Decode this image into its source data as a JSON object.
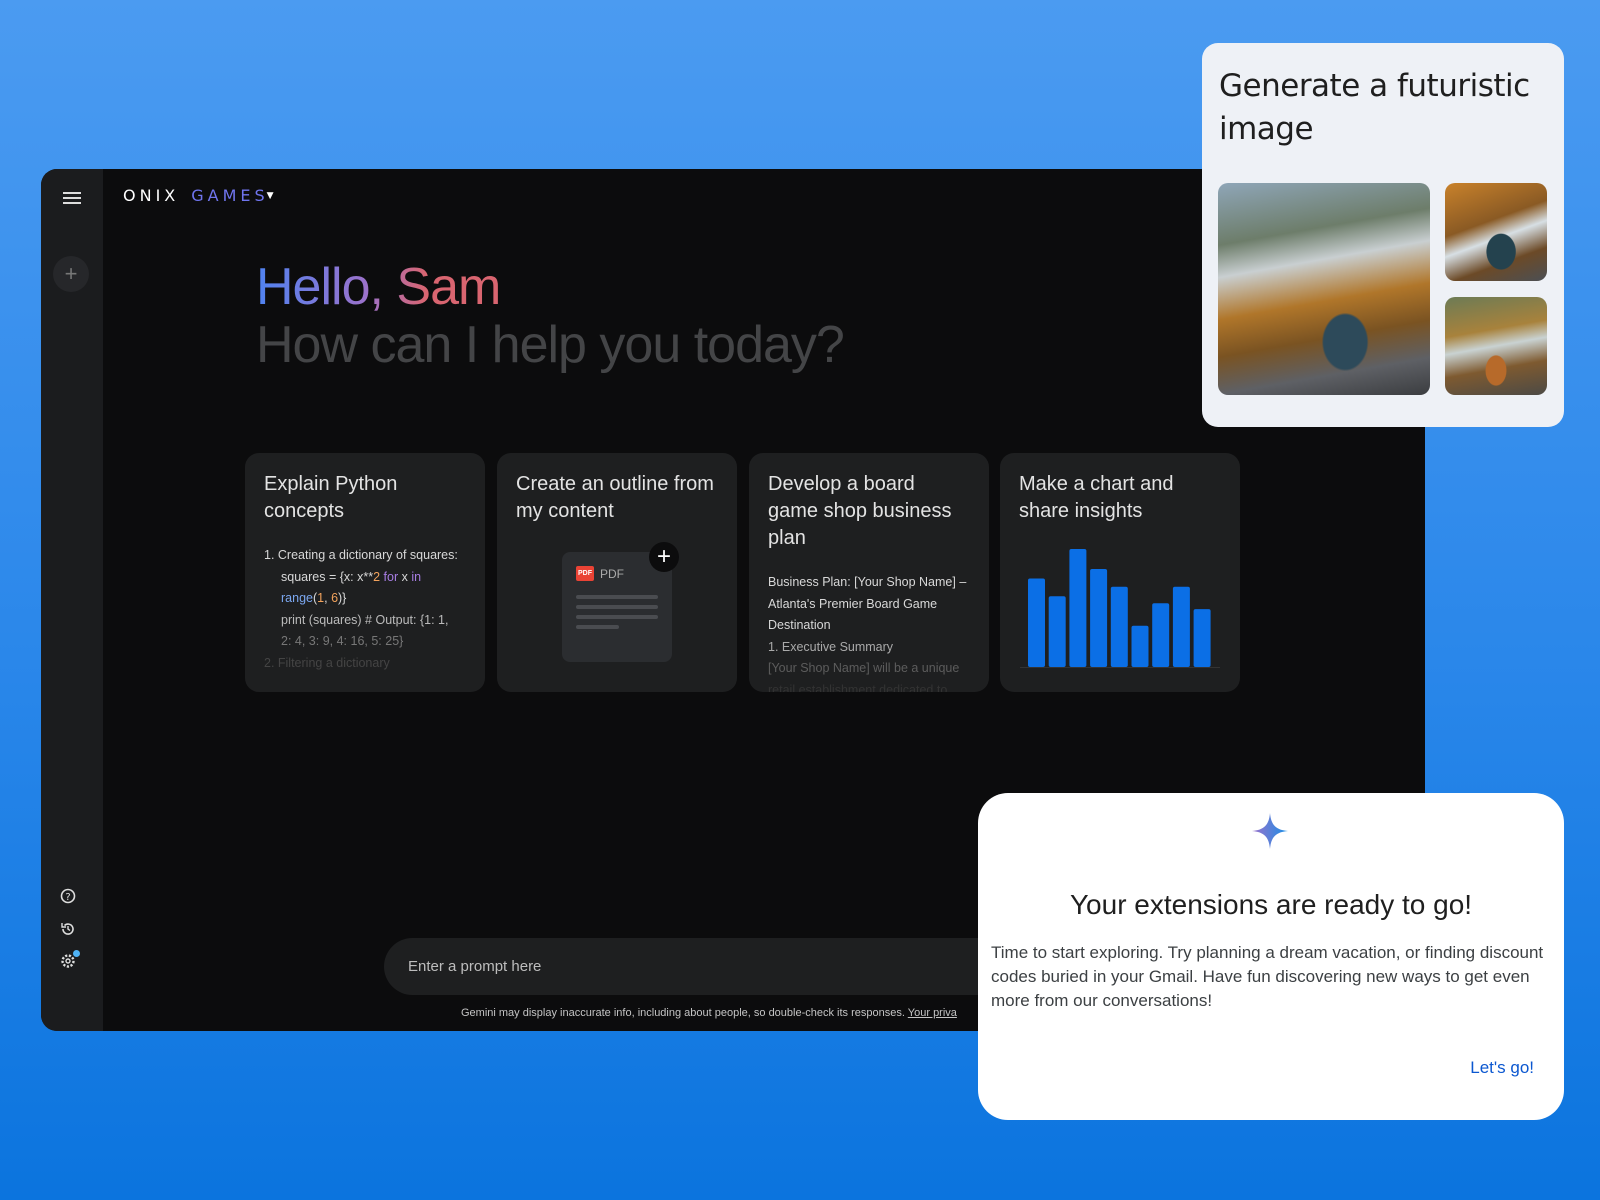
{
  "app": {
    "logo_primary": "ONIX",
    "logo_secondary": "GAMES"
  },
  "greeting": {
    "hello": "Hello, Sam",
    "subtitle": "How can I help you today?"
  },
  "cards": [
    {
      "title": "Explain Python concepts",
      "lines": [
        "1. Creating a dictionary of squares:",
        "squares = {x: x**2 for x in",
        "range(1, 6)}",
        "print (squares)  # Output: {1: 1,",
        "2: 4, 3: 9, 4: 16, 5: 25}",
        "2. Filtering a dictionary"
      ]
    },
    {
      "title": "Create an outline from my content",
      "pdf_label": "PDF",
      "pdf_badge": "PDF"
    },
    {
      "title": "Develop a board game shop business plan",
      "lines": [
        "Business Plan: [Your Shop Name] –",
        "Atlanta's Premier Board Game",
        "Destination",
        "1. Executive Summary",
        "[Your Shop Name] will be a unique",
        "retail establishment dedicated to"
      ]
    },
    {
      "title": "Make a chart and share insights",
      "bars": [
        75,
        60,
        100,
        83,
        68,
        35,
        54,
        68,
        49
      ],
      "bar_color": "#0b6fe6"
    }
  ],
  "prompt": {
    "placeholder": "Enter a prompt here"
  },
  "disclaimer": {
    "text": "Gemini may display inaccurate info, including about people, so double-check its responses.",
    "link": "Your priva"
  },
  "image_card": {
    "title": "Generate a futuristic image"
  },
  "popup": {
    "title": "Your extensions are ready to go!",
    "body": "Time to start exploring. Try planning a dream vacation, or finding discount codes buried in your Gmail. Have fun discovering new ways to get even more from our conversations!",
    "button": "Let's go!"
  }
}
